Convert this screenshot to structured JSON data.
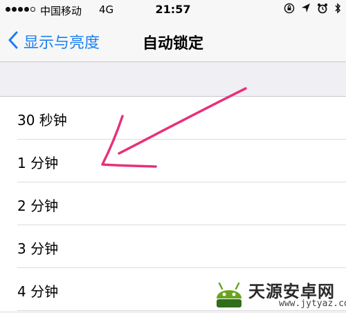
{
  "status_bar": {
    "carrier": "中国移动",
    "network": "4G",
    "time": "21:57",
    "signal_bars_filled": 4,
    "signal_bars_total": 5,
    "icons": [
      "orientation-lock-icon",
      "location-arrow-icon",
      "alarm-icon",
      "bluetooth-icon"
    ]
  },
  "nav": {
    "back_label": "显示与亮度",
    "title": "自动锁定"
  },
  "options": [
    {
      "label": "30 秒钟"
    },
    {
      "label": "1 分钟"
    },
    {
      "label": "2 分钟"
    },
    {
      "label": "3 分钟"
    },
    {
      "label": "4 分钟"
    }
  ],
  "colors": {
    "accent": "#1a7df2",
    "annotation": "#e8307a",
    "background": "#efeff4"
  },
  "watermark": {
    "name": "天源安卓网",
    "url": "www.jytyaz.com"
  }
}
